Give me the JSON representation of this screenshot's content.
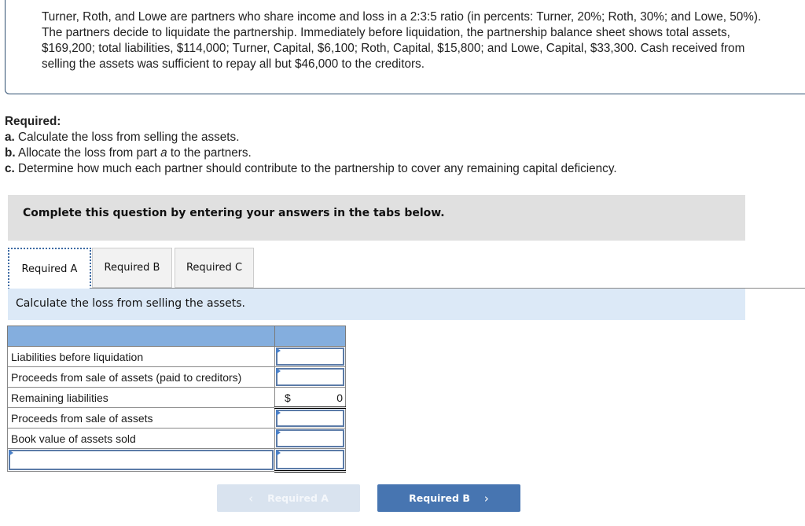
{
  "problem": {
    "text": "Turner, Roth, and Lowe are partners who share income and loss in a 2:3:5 ratio (in percents: Turner, 20%; Roth, 30%; and Lowe, 50%). The partners decide to liquidate the partnership. Immediately before liquidation, the partnership balance sheet shows total assets, $169,200; total liabilities, $114,000; Turner, Capital, $6,100; Roth, Capital, $15,800; and Lowe, Capital, $33,300. Cash received from selling the assets was sufficient to repay all but $46,000 to the creditors."
  },
  "required": {
    "heading": "Required:",
    "items": [
      {
        "letter": "a.",
        "text": "Calculate the loss from selling the assets."
      },
      {
        "letter": "b.",
        "text_before": "Allocate the loss from part ",
        "italic": "a",
        "text_after": " to the partners."
      },
      {
        "letter": "c.",
        "text": "Determine how much each partner should contribute to the partnership to cover any remaining capital deficiency."
      }
    ]
  },
  "banner": "Complete this question by entering your answers in the tabs below.",
  "tabs": [
    {
      "label": "Required A",
      "active": true
    },
    {
      "label": "Required B",
      "active": false
    },
    {
      "label": "Required C",
      "active": false
    }
  ],
  "instruction": "Calculate the loss from selling the assets.",
  "table": {
    "rows": [
      {
        "label": "Liabilities before liquidation",
        "value": ""
      },
      {
        "label": "Proceeds from sale of assets (paid to creditors)",
        "value": ""
      },
      {
        "label": "Remaining liabilities",
        "currency": "$",
        "value": "0"
      },
      {
        "label": "Proceeds from sale of assets",
        "value": ""
      },
      {
        "label": "Book value of assets sold",
        "value": ""
      },
      {
        "label": "",
        "value": ""
      }
    ]
  },
  "nav": {
    "prev_label": "Required A",
    "next_label": "Required B",
    "prev_icon": "‹",
    "next_icon": "›"
  }
}
